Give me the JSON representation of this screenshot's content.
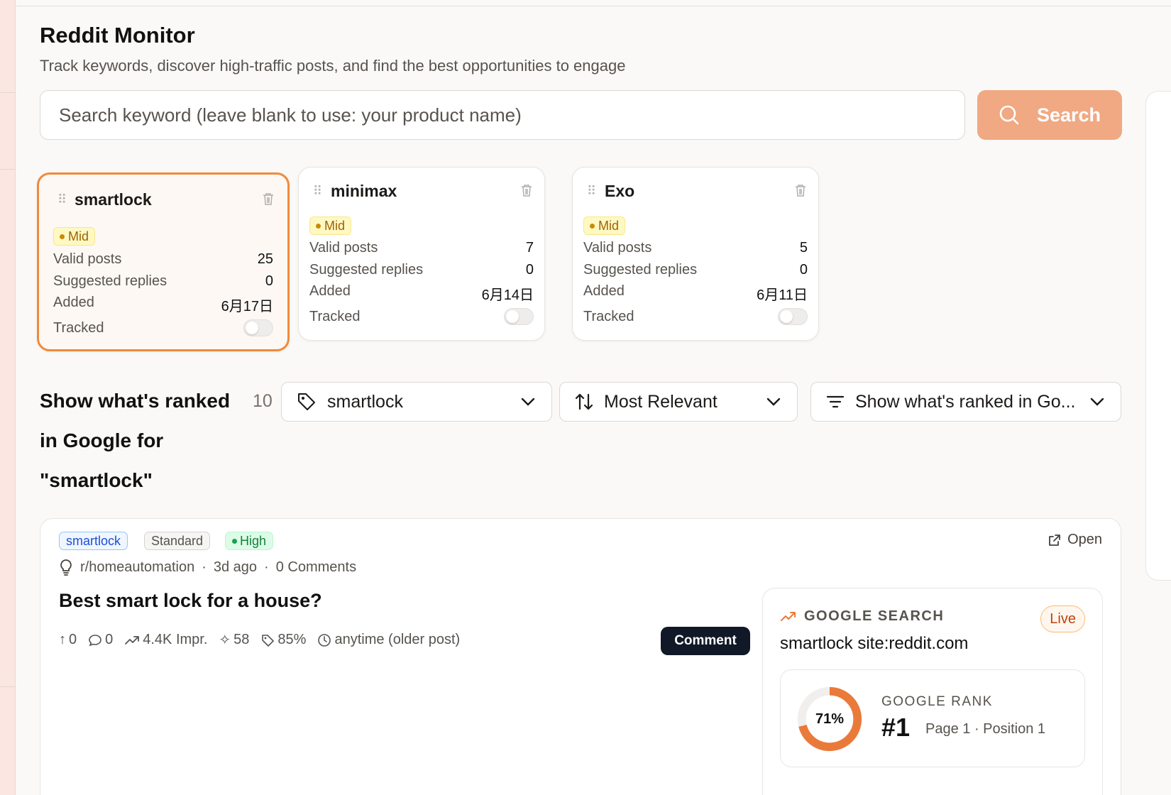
{
  "header": {
    "title": "Reddit Monitor",
    "subtitle": "Track keywords, discover high-traffic posts, and find the best opportunities to engage"
  },
  "search": {
    "placeholder": "Search keyword (leave blank to use: your product name)",
    "button_label": "Search",
    "icon": "search-icon"
  },
  "keywords": [
    {
      "name": "smartlock",
      "level": "Mid",
      "valid_posts_label": "Valid posts",
      "valid_posts": "25",
      "suggested_label": "Suggested replies",
      "suggested": "0",
      "added_label": "Added",
      "added": "6月17日",
      "tracked_label": "Tracked",
      "tracked": false,
      "selected": true
    },
    {
      "name": "minimax",
      "level": "Mid",
      "valid_posts_label": "Valid posts",
      "valid_posts": "7",
      "suggested_label": "Suggested replies",
      "suggested": "0",
      "added_label": "Added",
      "added": "6月14日",
      "tracked_label": "Tracked",
      "tracked": false,
      "selected": false
    },
    {
      "name": "Exo",
      "level": "Mid",
      "valid_posts_label": "Valid posts",
      "valid_posts": "5",
      "suggested_label": "Suggested replies",
      "suggested": "0",
      "added_label": "Added",
      "added": "6月11日",
      "tracked_label": "Tracked",
      "tracked": false,
      "selected": false
    }
  ],
  "results": {
    "title": "Show what's ranked in Google for \"smartlock\"",
    "count": "10",
    "keyword_filter": "smartlock",
    "sort": "Most Relevant",
    "view_filter": "Show what's ranked in Go..."
  },
  "post": {
    "tags": {
      "keyword": "smartlock",
      "type": "Standard",
      "priority": "High"
    },
    "open_label": "Open",
    "subreddit": "r/homeautomation",
    "age": "3d ago",
    "comments": "0 Comments",
    "title": "Best smart lock for a house?",
    "stats": {
      "upvotes": "0",
      "replies": "0",
      "impressions": "4.4K Impr.",
      "score": "58",
      "relevance": "85%",
      "timeframe": "anytime (older post)"
    },
    "comment_button": "Comment"
  },
  "google": {
    "label": "GOOGLE SEARCH",
    "status": "Live",
    "query": "smartlock site:reddit.com",
    "rank_label": "GOOGLE RANK",
    "rank": "#1",
    "position": "Page 1 · Position 1",
    "percent_text": "71%",
    "percent_value": 0.71
  },
  "colors": {
    "accent": "#f08a3c",
    "search_button": "#f0a982",
    "ring": "#ea7a3a",
    "dark_button": "#111827"
  }
}
